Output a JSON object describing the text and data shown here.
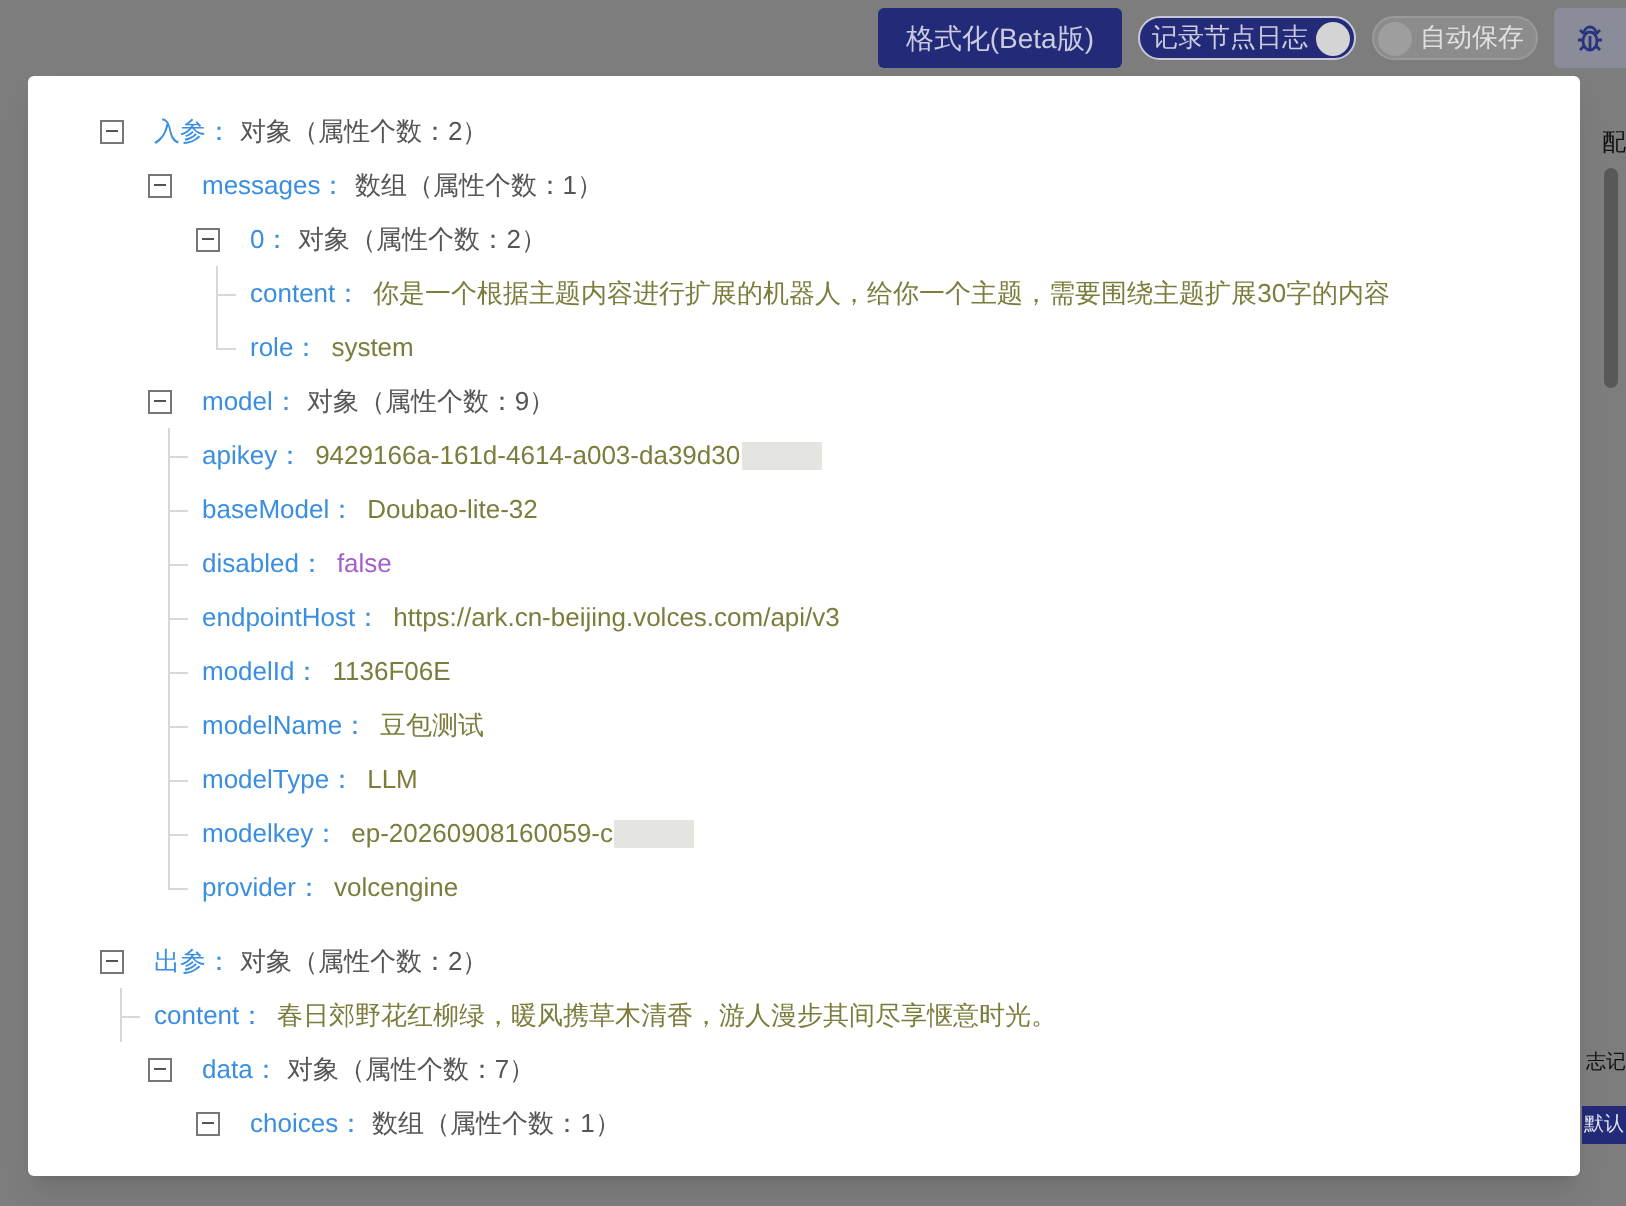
{
  "toolbar": {
    "format_button": "格式化(Beta版)",
    "toggles": [
      {
        "label": "记录节点日志",
        "on": true
      },
      {
        "label": "自动保存",
        "on": false
      }
    ]
  },
  "background_fragments": [
    {
      "text": "配"
    },
    {
      "text": "志记"
    },
    {
      "text": "默认"
    }
  ],
  "tree": [
    {
      "key": "入参：",
      "kind": "object",
      "summary": "对象（属性个数：2）",
      "expanded": true,
      "children": [
        {
          "key": "messages：",
          "kind": "object",
          "summary": "数组（属性个数：1）",
          "expanded": true,
          "children": [
            {
              "key": "0：",
              "kind": "object",
              "summary": "对象（属性个数：2）",
              "expanded": true,
              "children": [
                {
                  "key": "content：",
                  "kind": "string",
                  "value": "你是一个根据主题内容进行扩展的机器人，给你一个主题，需要围绕主题扩展30字的内容",
                  "redacted": false
                },
                {
                  "key": "role：",
                  "kind": "string",
                  "value": "system",
                  "redacted": false
                }
              ]
            }
          ]
        },
        {
          "key": "model：",
          "kind": "object",
          "summary": "对象（属性个数：9）",
          "expanded": true,
          "children": [
            {
              "key": "apikey：",
              "kind": "string",
              "value": "9429166a-161d-4614-a003-da39d30",
              "redacted": true
            },
            {
              "key": "baseModel：",
              "kind": "string",
              "value": "Doubao-lite-32",
              "redacted": false
            },
            {
              "key": "disabled：",
              "kind": "boolean",
              "value": "false",
              "redacted": false
            },
            {
              "key": "endpointHost：",
              "kind": "string",
              "value": "https://ark.cn-beijing.volces.com/api/v3",
              "redacted": false
            },
            {
              "key": "modelId：",
              "kind": "string",
              "value": "1136F06E",
              "redacted": false
            },
            {
              "key": "modelName：",
              "kind": "string",
              "value": "豆包测试",
              "redacted": false
            },
            {
              "key": "modelType：",
              "kind": "string",
              "value": "LLM",
              "redacted": false
            },
            {
              "key": "modelkey：",
              "kind": "string",
              "value": "ep-20260908160059-c",
              "redacted": true
            },
            {
              "key": "provider：",
              "kind": "string",
              "value": "volcengine",
              "redacted": false
            }
          ]
        }
      ]
    },
    {
      "key": "出参：",
      "kind": "object",
      "summary": "对象（属性个数：2）",
      "expanded": true,
      "children": [
        {
          "key": "content：",
          "kind": "string",
          "value": "春日郊野花红柳绿，暖风携草木清香，游人漫步其间尽享惬意时光。",
          "redacted": false
        },
        {
          "key": "data：",
          "kind": "object",
          "summary": "对象（属性个数：7）",
          "expanded": true,
          "children": [
            {
              "key": "choices：",
              "kind": "object",
              "summary": "数组（属性个数：1）",
              "expanded": true
            }
          ]
        }
      ]
    }
  ]
}
